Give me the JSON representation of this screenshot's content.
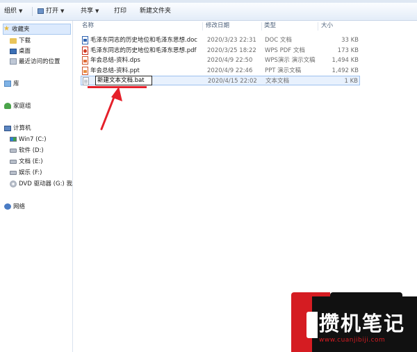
{
  "toolbar": {
    "organize": "组织",
    "open": "打开",
    "share": "共享",
    "print": "打印",
    "new_folder": "新建文件夹"
  },
  "sidebar": {
    "favorites": "收藏夹",
    "downloads": "下载",
    "desktop": "桌面",
    "recent": "最近访问的位置",
    "libraries": "库",
    "homegroup": "家庭组",
    "computer": "计算机",
    "drives": [
      {
        "label": "Win7 (C:)"
      },
      {
        "label": "软件 (D:)"
      },
      {
        "label": "文档 (E:)"
      },
      {
        "label": "娱乐 (F:)"
      },
      {
        "label": "DVD 驱动器 (G:) 我"
      }
    ],
    "network": "网络"
  },
  "columns": {
    "name": "名称",
    "date": "修改日期",
    "type": "类型",
    "size": "大小"
  },
  "files": [
    {
      "name": "毛泽东同志的历史地位和毛泽东思想.doc",
      "date": "2020/3/23 22:31",
      "type": "DOC 文档",
      "size": "33 KB",
      "icon": "doc"
    },
    {
      "name": "毛泽东同志的历史地位和毛泽东思想.pdf",
      "date": "2020/3/25 18:22",
      "type": "WPS PDF 文档",
      "size": "173 KB",
      "icon": "pdf"
    },
    {
      "name": "年会总结-资料.dps",
      "date": "2020/4/9 22:50",
      "type": "WPS演示 演示文稿",
      "size": "1,494 KB",
      "icon": "dps"
    },
    {
      "name": "年会总结-资料.ppt",
      "date": "2020/4/9 22:46",
      "type": "PPT 演示文稿",
      "size": "1,492 KB",
      "icon": "ppt"
    },
    {
      "name": "新建文本文档.bat",
      "date": "2020/4/15 22:02",
      "type": "文本文档",
      "size": "1 KB",
      "icon": "txt"
    }
  ],
  "watermark": {
    "title": "攒机笔记",
    "url": "www.cuanjibiji.com"
  },
  "colors": {
    "accent_red": "#e5202a",
    "selection": "#dceafd"
  }
}
